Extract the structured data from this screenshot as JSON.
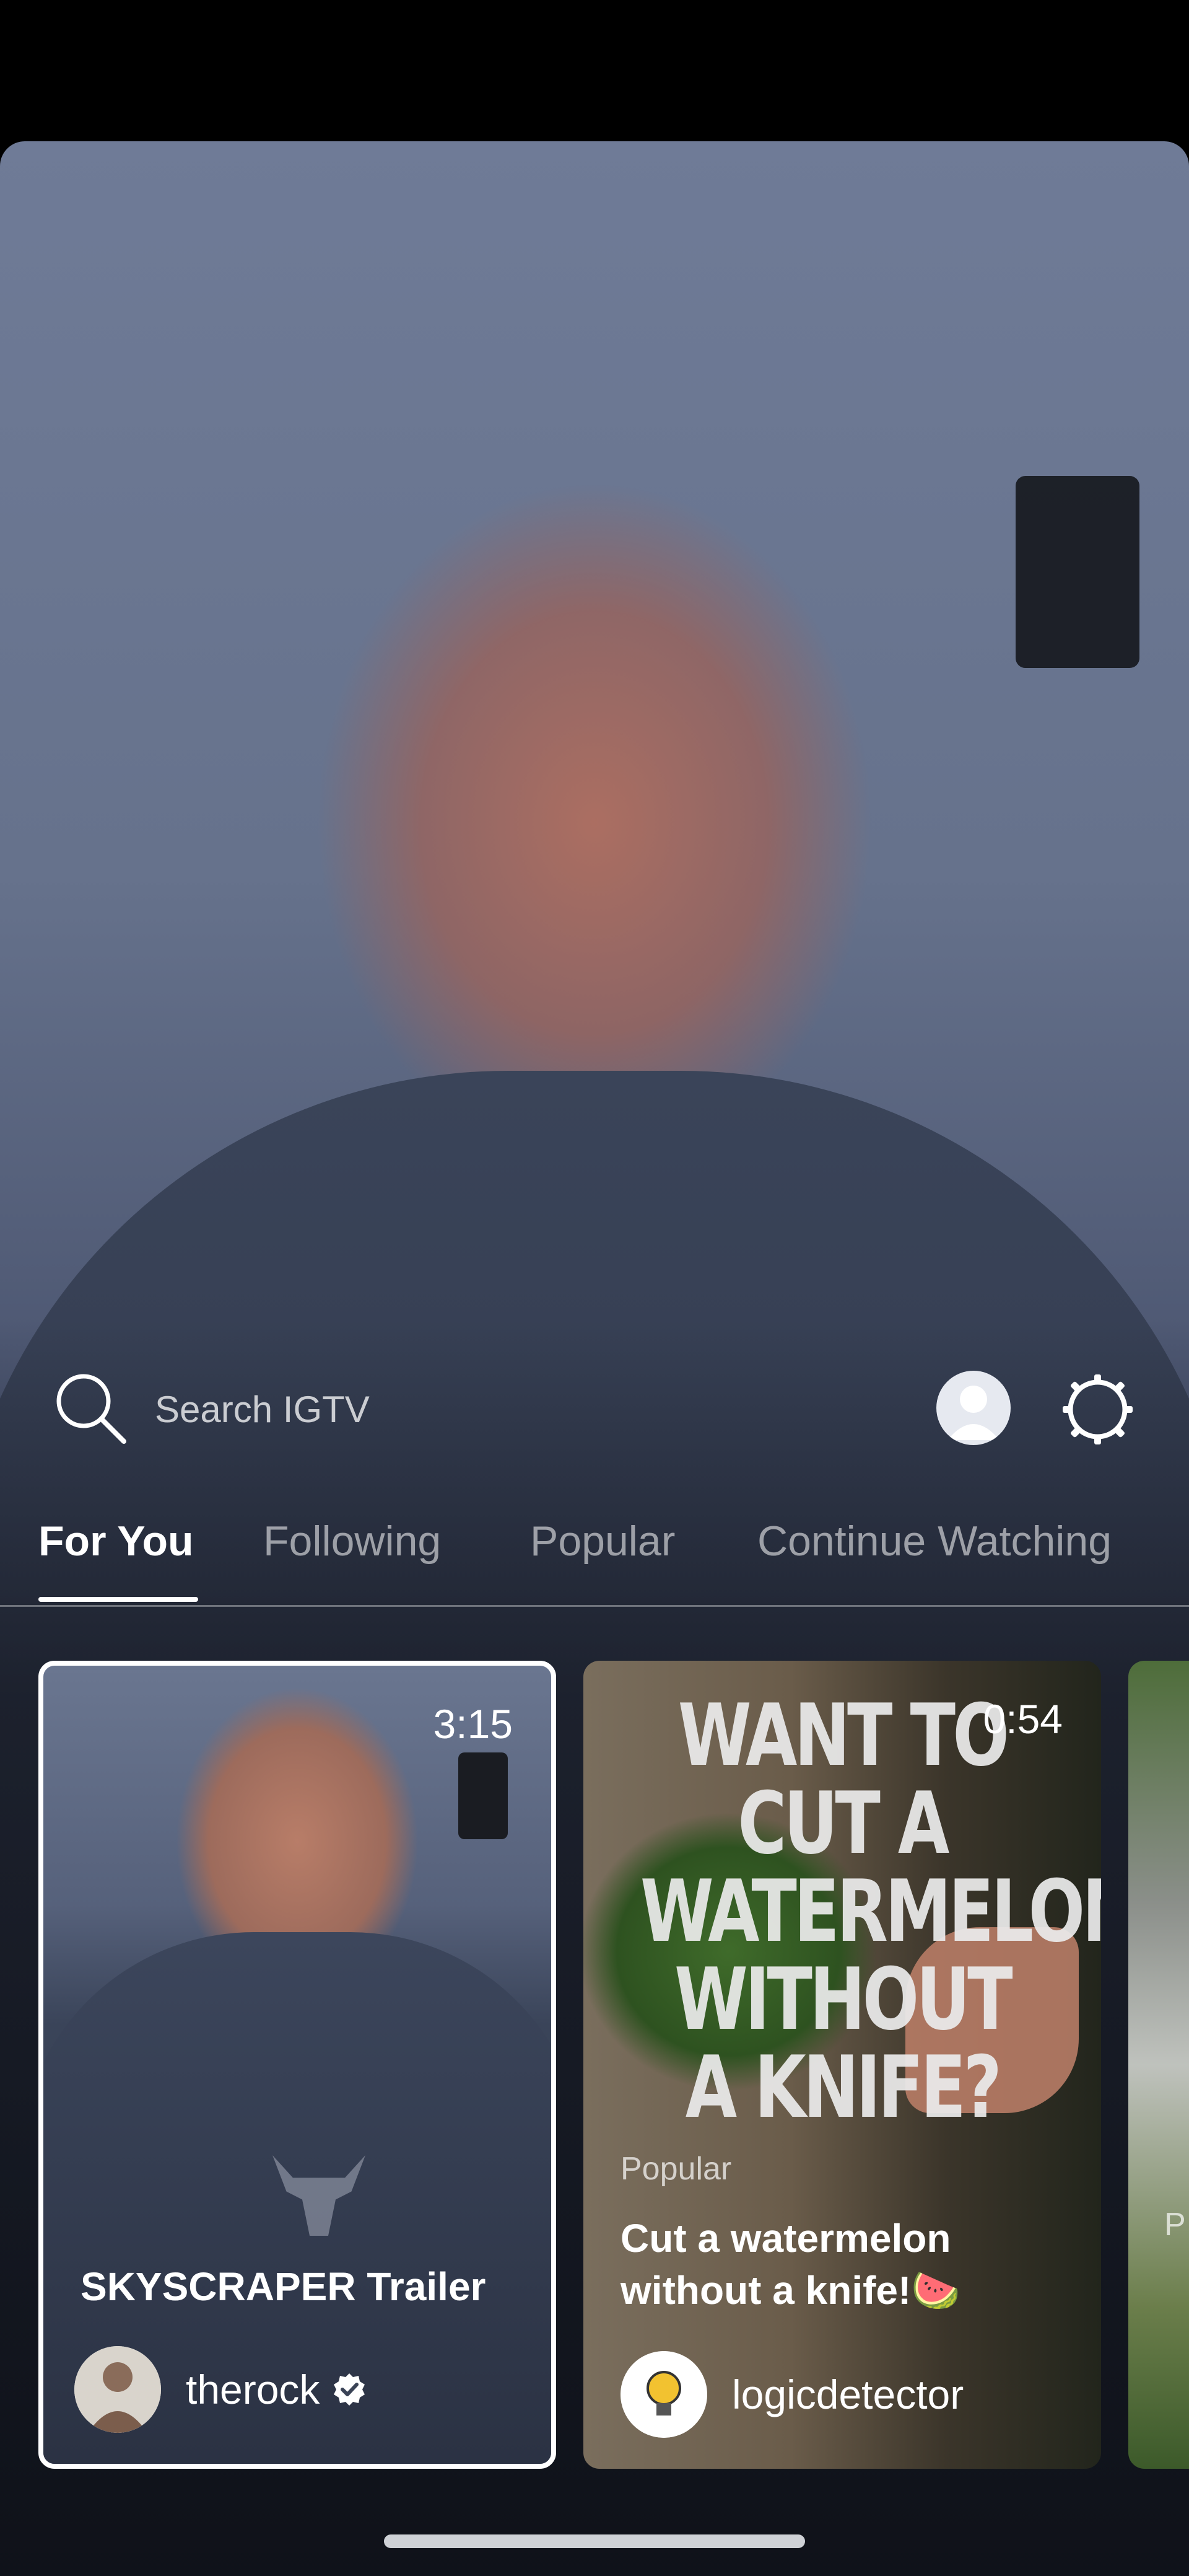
{
  "search": {
    "placeholder": "Search IGTV"
  },
  "tabs": [
    {
      "label": "For You",
      "active": true
    },
    {
      "label": "Following",
      "active": false
    },
    {
      "label": "Popular",
      "active": false
    },
    {
      "label": "Continue Watching",
      "active": false
    }
  ],
  "cards": [
    {
      "duration": "3:15",
      "category": "",
      "title": "SKYSCRAPER Trailer",
      "channel": "therock",
      "verified": true
    },
    {
      "duration": "0:54",
      "category": "Popular",
      "title_line1": "Cut a watermelon",
      "title_line2": "without a knife!🍉",
      "overlay_text": "WANT TO CUT A WATERMELON WITHOUT A KNIFE?",
      "channel": "logicdetector",
      "verified": false
    },
    {
      "category": "P",
      "channel": ""
    }
  ],
  "icons": {
    "search": "search-icon",
    "profile": "profile-avatar-icon",
    "settings": "gear-icon",
    "verified": "verified-badge-icon"
  },
  "colors": {
    "background": "#000000",
    "accent": "#ffffff"
  }
}
